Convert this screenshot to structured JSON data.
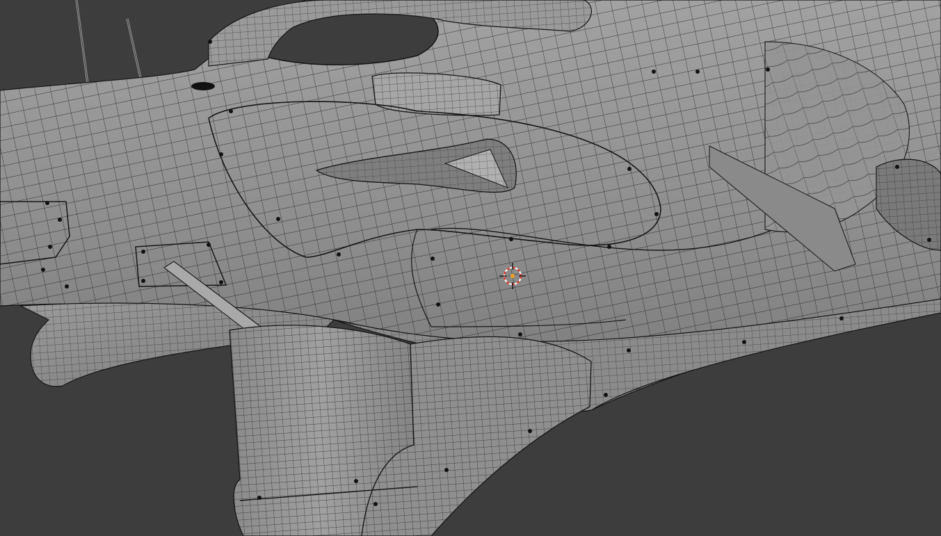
{
  "viewport": {
    "background_color": "#3d3d3d",
    "mesh_fill_color": "#8e8e8e",
    "mesh_highlight_color": "#a4a4a4",
    "mesh_shadow_color": "#6a6a6a",
    "wireframe_color": "#1a1a1a",
    "cursor_ring_color": "#e0301e",
    "cursor_center_color": "#f0a020"
  },
  "scene": {
    "object": "race-car-body-mesh",
    "display_mode": "solid-with-wireframe",
    "cursor_icon": "3d-cursor-icon"
  }
}
